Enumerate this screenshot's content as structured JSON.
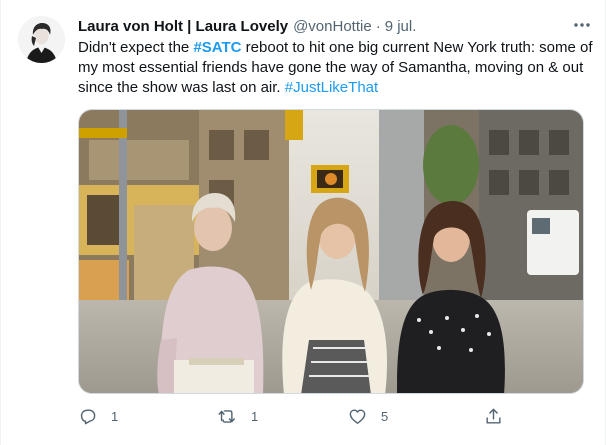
{
  "tweet": {
    "display_name": "Laura von Holt | Laura Lovely",
    "handle": "@vonHottie",
    "separator": "·",
    "date": "9 jul.",
    "more_label": "···",
    "text_1": "Didn't expect the ",
    "hashtag_satc": "#SATC",
    "text_2": " reboot to hit one big current New York truth: some of my most essential friends have gone the way of Samantha, moving on & out since the show was last on air. ",
    "hashtag_jlt": "#JustLikeThat"
  },
  "actions": {
    "reply_count": "1",
    "retweet_count": "1",
    "like_count": "5"
  },
  "icons": [
    "reply-icon",
    "retweet-icon",
    "like-icon",
    "share-icon",
    "more-icon"
  ],
  "colors": {
    "link": "#1d9bf0",
    "secondary_text": "#536471",
    "primary_text": "#0f1419"
  }
}
